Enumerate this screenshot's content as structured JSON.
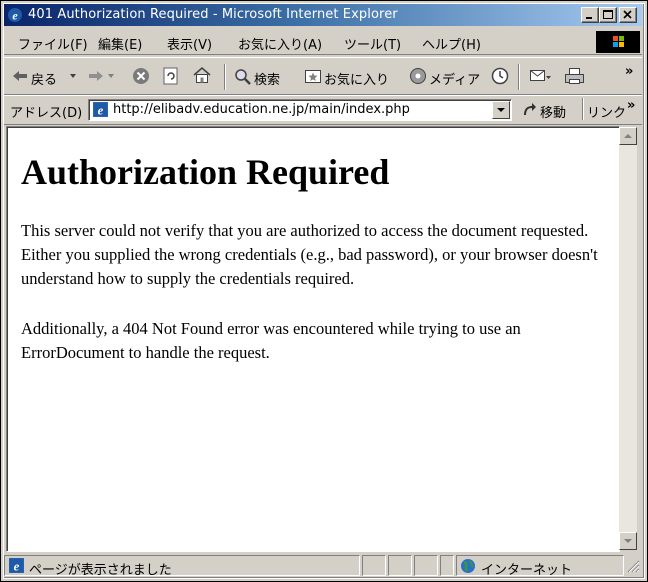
{
  "window": {
    "title": "401 Authorization Required - Microsoft Internet Explorer"
  },
  "menu": {
    "items": [
      "ファイル(F)",
      "編集(E)",
      "表示(V)",
      "お気に入り(A)",
      "ツール(T)",
      "ヘルプ(H)"
    ]
  },
  "toolbar": {
    "back_label": "戻る",
    "search_label": "検索",
    "favorites_label": "お気に入り",
    "media_label": "メディア",
    "more": "»"
  },
  "address": {
    "label": "アドレス(D)",
    "url": "http://elibadv.education.ne.jp/main/index.php",
    "go_label": "移動",
    "links_label": "リンク",
    "links_more": "»"
  },
  "page": {
    "heading": "Authorization Required",
    "paragraph1": "This server could not verify that you are authorized to access the document requested. Either you supplied the wrong credentials (e.g., bad password), or your browser doesn't understand how to supply the credentials required.",
    "paragraph2": "Additionally, a 404 Not Found error was encountered while trying to use an ErrorDocument to handle the request."
  },
  "status": {
    "text": "ページが表示されました",
    "zone": "インターネット"
  }
}
